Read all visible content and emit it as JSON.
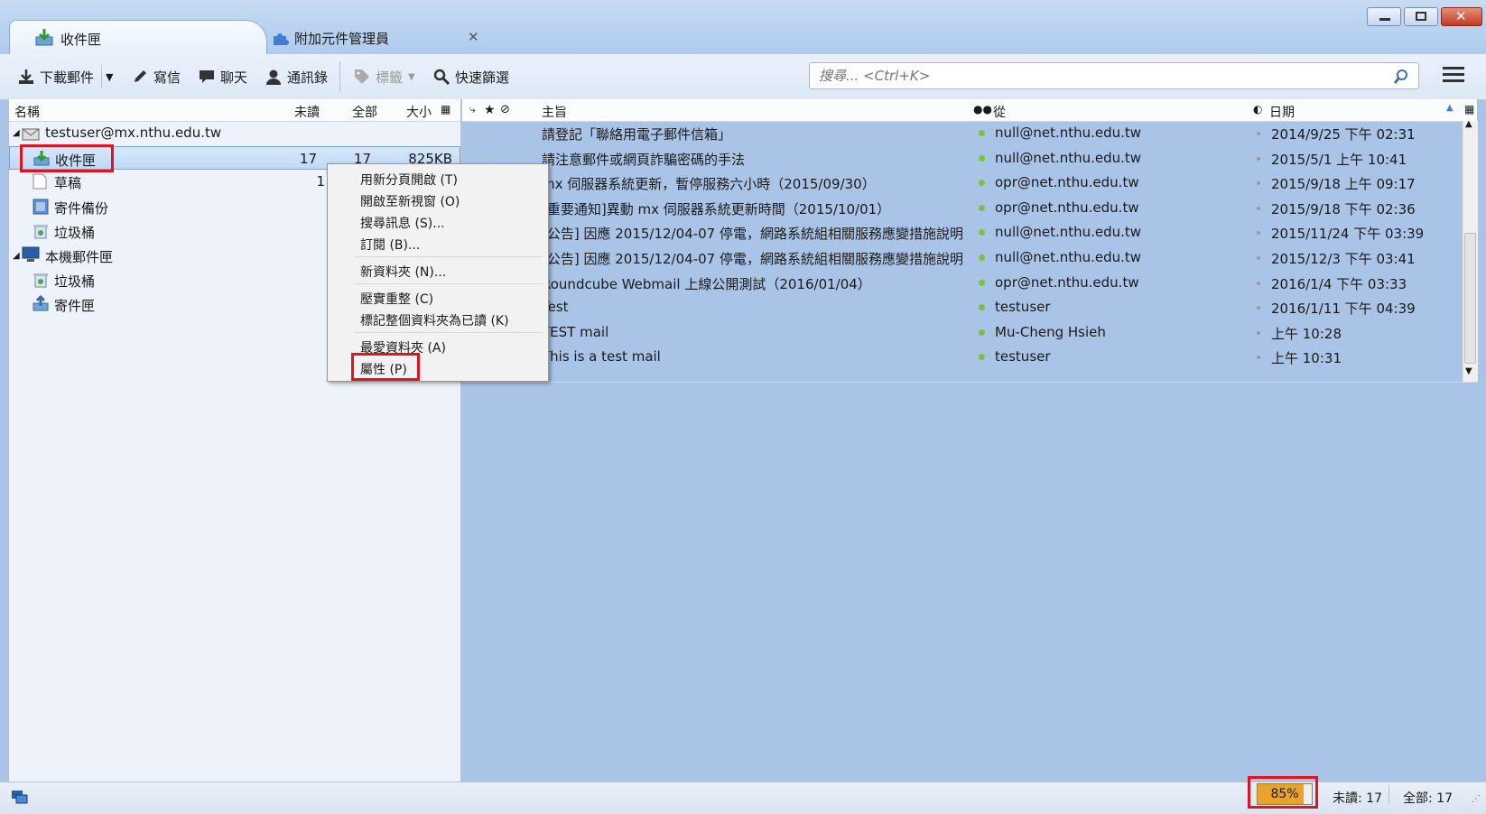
{
  "window": {
    "tabs": [
      {
        "label": "收件匣",
        "icon": "inbox-download-icon"
      },
      {
        "label": "附加元件管理員",
        "icon": "puzzle-icon"
      }
    ]
  },
  "toolbar": {
    "get_mail": "下載郵件",
    "write": "寫信",
    "chat": "聊天",
    "address_book": "通訊錄",
    "tag": "標籤",
    "quick_filter": "快速篩選",
    "search_placeholder": "搜尋... <Ctrl+K>"
  },
  "folder_pane": {
    "columns": {
      "name": "名稱",
      "unread": "未讀",
      "total": "全部",
      "size": "大小"
    },
    "account": "testuser@mx.nthu.edu.tw",
    "folders": [
      {
        "label": "收件匣",
        "unread": "17",
        "total": "17",
        "size": "825KB"
      },
      {
        "label": "草稿",
        "unread": "1"
      },
      {
        "label": "寄件備份"
      },
      {
        "label": "垃圾桶"
      }
    ],
    "local_account": "本機郵件匣",
    "local_folders": [
      {
        "label": "垃圾桶"
      },
      {
        "label": "寄件匣"
      }
    ]
  },
  "context_menu": {
    "items": [
      "用新分頁開啟 (T)",
      "開啟至新視窗 (O)",
      "搜尋訊息 (S)...",
      "訂閱 (B)...",
      "新資料夾 (N)...",
      "壓實重整 (C)",
      "標記整個資料夾為已讀 (K)",
      "最愛資料夾 (A)",
      "屬性 (P)"
    ]
  },
  "message_list": {
    "columns": {
      "subject": "主旨",
      "from": "從",
      "date": "日期"
    },
    "messages": [
      {
        "subject": "請登記「聯絡用電子郵件信箱」",
        "from": "null@net.nthu.edu.tw",
        "date": "2014/9/25 下午 02:31"
      },
      {
        "subject": "請注意郵件或網頁詐騙密碼的手法",
        "from": "null@net.nthu.edu.tw",
        "date": "2015/5/1 上午 10:41"
      },
      {
        "subject": "mx 伺服器系統更新，暫停服務六小時（2015/09/30）",
        "from": "opr@net.nthu.edu.tw",
        "date": "2015/9/18 上午 09:17"
      },
      {
        "subject": "[重要通知]異動 mx 伺服器系統更新時間（2015/10/01）",
        "from": "opr@net.nthu.edu.tw",
        "date": "2015/9/18 下午 02:36"
      },
      {
        "subject": "[公告] 因應 2015/12/04-07 停電，網路系統組相關服務應變措施說明",
        "from": "null@net.nthu.edu.tw",
        "date": "2015/11/24 下午 03:39"
      },
      {
        "subject": "[公告] 因應 2015/12/04-07 停電，網路系統組相關服務應變措施說明",
        "from": "null@net.nthu.edu.tw",
        "date": "2015/12/3 下午 03:41"
      },
      {
        "subject": "Roundcube Webmail 上線公開測試（2016/01/04）",
        "from": "opr@net.nthu.edu.tw",
        "date": "2016/1/4 下午 03:33"
      },
      {
        "subject": "Test",
        "from": "testuser",
        "date": "2016/1/11 下午 04:39"
      },
      {
        "subject": "TEST mail",
        "from": "Mu-Cheng Hsieh",
        "date": "上午 10:28"
      },
      {
        "subject": "This is a test mail",
        "from": "testuser",
        "date": "上午 10:31"
      }
    ]
  },
  "status": {
    "quota": "85%",
    "quota_fraction": 0.85,
    "unread": "未讀: 17",
    "total": "全部: 17"
  },
  "colors": {
    "highlight": "#e0141e",
    "quota": "#e7a32c",
    "status_dot": "#7ac143"
  }
}
